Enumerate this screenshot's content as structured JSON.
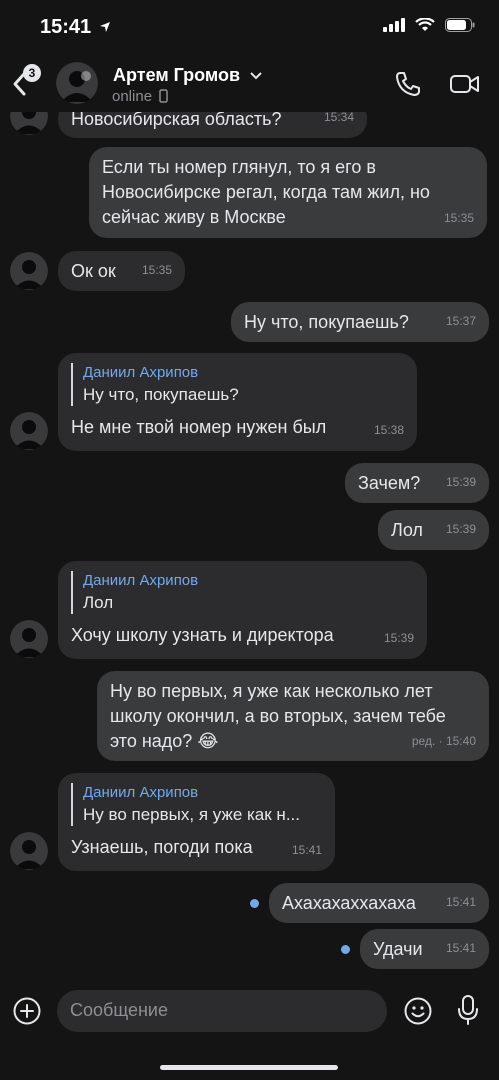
{
  "status": {
    "time": "15:41"
  },
  "header": {
    "unread_count": "3",
    "contact_name": "Артем Громов",
    "status_text": "online"
  },
  "messages": [
    {
      "type": "in",
      "text": "Новосибирская область?",
      "time": "15:34"
    },
    {
      "type": "out",
      "text": "Если ты номер глянул, то я его в Новосибирске регал, когда там жил, но сейчас живу в Москве",
      "time": "15:35"
    },
    {
      "type": "in",
      "text": "Ок ок",
      "time": "15:35"
    },
    {
      "type": "out",
      "text": "Ну что, покупаешь?",
      "time": "15:37"
    },
    {
      "type": "in",
      "reply_name": "Даниил Ахрипов",
      "reply_text": "Ну что, покупаешь?",
      "text": "Не мне твой номер нужен был",
      "time": "15:38"
    },
    {
      "type": "out",
      "text": "Зачем?",
      "time": "15:39"
    },
    {
      "type": "out",
      "text": "Лол",
      "time": "15:39"
    },
    {
      "type": "in",
      "reply_name": "Даниил Ахрипов",
      "reply_text": "Лол",
      "text": "Хочу школу узнать и директора",
      "time": "15:39"
    },
    {
      "type": "out",
      "text": "Ну во первых, я уже как несколько лет школу окончил, а во вторых, зачем тебе это надо? 😂",
      "time": "ред. · 15:40"
    },
    {
      "type": "in",
      "reply_name": "Даниил Ахрипов",
      "reply_text": "Ну во первых, я уже как н...",
      "text": "Узнаешь, погоди пока",
      "time": "15:41"
    },
    {
      "type": "out",
      "text": "Ахахахаххахаха",
      "time": "15:41"
    },
    {
      "type": "out",
      "text": "Удачи",
      "time": "15:41"
    }
  ],
  "composer": {
    "placeholder": "Сообщение"
  },
  "colors": {
    "background": "#141415",
    "incoming": "#2c2c2e",
    "outgoing": "#3a3b3d",
    "accent": "#71aaeb"
  },
  "icons": [
    "back-icon",
    "phone-icon",
    "video-icon",
    "add-icon",
    "emoji-icon",
    "mic-icon",
    "signal-icon",
    "wifi-icon",
    "battery-icon",
    "location-arrow-icon",
    "device-icon"
  ]
}
